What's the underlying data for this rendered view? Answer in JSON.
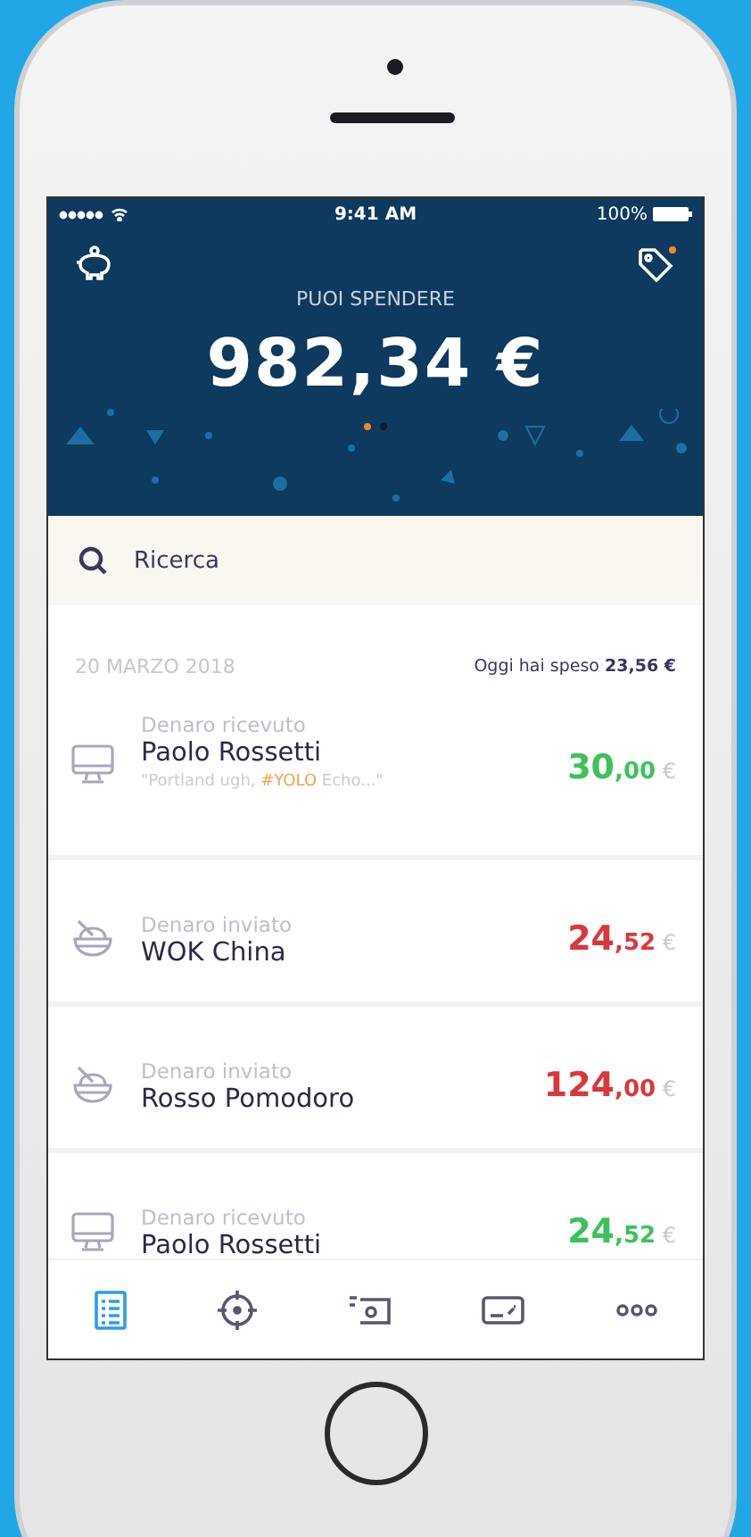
{
  "status_bar": {
    "time": "9:41 AM",
    "battery": "100%"
  },
  "header": {
    "label": "PUOI SPENDERE",
    "balance": "982,34 €",
    "pages": [
      {
        "selected": true
      },
      {
        "selected": false
      }
    ]
  },
  "search": {
    "placeholder": "Ricerca"
  },
  "day": {
    "date": "20 MARZO 2018",
    "spent_label": "Oggi hai speso",
    "spent_amount": "23,56 €"
  },
  "transactions": [
    {
      "kind": "received",
      "type": "Denaro ricevuto",
      "name": "Paolo Rossetti",
      "note": [
        {
          "text": "\"Portland ugh, ",
          "tag": false
        },
        {
          "text": "#YOLO",
          "tag": true
        },
        {
          "text": " Echo...\"",
          "tag": false
        }
      ],
      "amount": "30",
      "cents": ",00",
      "currency": "€"
    },
    {
      "kind": "sent",
      "type": "Denaro inviato",
      "name": "WOK China",
      "amount": "24",
      "cents": ",52",
      "currency": "€"
    },
    {
      "kind": "sent",
      "type": "Denaro inviato",
      "name": "Rosso Pomodoro",
      "amount": "124",
      "cents": ",00",
      "currency": "€"
    },
    {
      "kind": "received",
      "type": "Denaro ricevuto",
      "name": "Paolo Rossetti",
      "amount": "24",
      "cents": ",52",
      "currency": "€"
    }
  ],
  "tabs": [
    {
      "kind": "list",
      "selected": true
    },
    {
      "kind": "target",
      "selected": false
    },
    {
      "kind": "cash",
      "selected": false
    },
    {
      "kind": "card",
      "selected": false
    },
    {
      "kind": "more",
      "selected": false
    }
  ]
}
